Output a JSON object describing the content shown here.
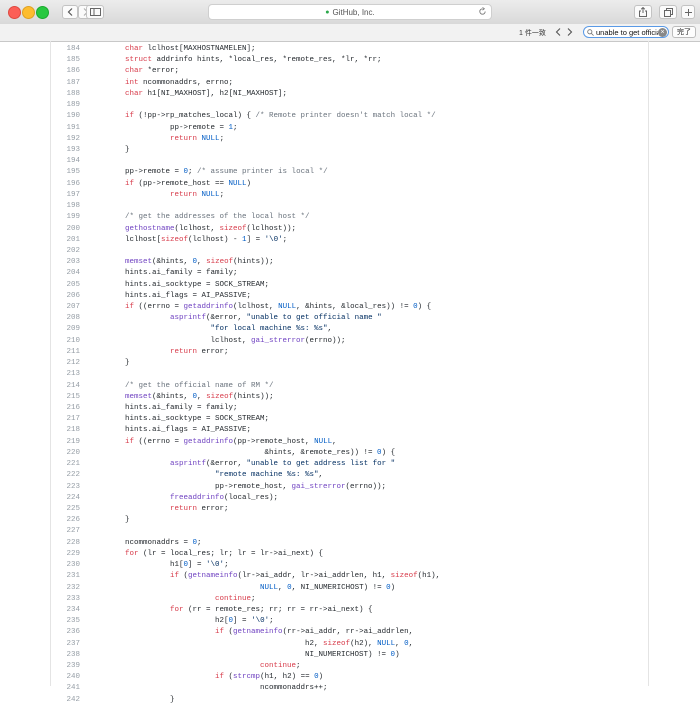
{
  "browser": {
    "address_text": "GitHub, Inc.",
    "find_match_count": "1 件一致",
    "find_query": "unable to get officia",
    "done_label": "完了"
  },
  "code": [
    {
      "n": "184",
      "t": [
        {
          "c": "k",
          "v": "char"
        },
        {
          "v": " lclhost[MAXHOSTNAMELEN];"
        }
      ]
    },
    {
      "n": "185",
      "t": [
        {
          "c": "k",
          "v": "struct"
        },
        {
          "v": " addrinfo hints, *local_res, *remote_res, *lr, *rr;"
        }
      ]
    },
    {
      "n": "186",
      "t": [
        {
          "c": "k",
          "v": "char"
        },
        {
          "v": " *error;"
        }
      ]
    },
    {
      "n": "187",
      "t": [
        {
          "c": "k",
          "v": "int"
        },
        {
          "v": " ncommonaddrs, errno;"
        }
      ]
    },
    {
      "n": "188",
      "t": [
        {
          "c": "k",
          "v": "char"
        },
        {
          "v": " h1[NI_MAXHOST], h2[NI_MAXHOST];"
        }
      ]
    },
    {
      "n": "189",
      "t": []
    },
    {
      "n": "190",
      "t": [
        {
          "c": "k",
          "v": "if"
        },
        {
          "v": " (!pp->rp_matches_local) { "
        },
        {
          "c": "c",
          "v": "/* Remote printer doesn't match local */"
        }
      ]
    },
    {
      "n": "191",
      "t": [
        {
          "v": "          pp->remote = "
        },
        {
          "c": "n",
          "v": "1"
        },
        {
          "v": ";"
        }
      ]
    },
    {
      "n": "192",
      "t": [
        {
          "v": "          "
        },
        {
          "c": "k",
          "v": "return"
        },
        {
          "v": " "
        },
        {
          "c": "n",
          "v": "NULL"
        },
        {
          "v": ";"
        }
      ]
    },
    {
      "n": "193",
      "t": [
        {
          "v": "}"
        }
      ]
    },
    {
      "n": "194",
      "t": []
    },
    {
      "n": "195",
      "t": [
        {
          "v": "pp->remote = "
        },
        {
          "c": "n",
          "v": "0"
        },
        {
          "v": "; "
        },
        {
          "c": "c",
          "v": "/* assume printer is local */"
        }
      ]
    },
    {
      "n": "196",
      "t": [
        {
          "c": "k",
          "v": "if"
        },
        {
          "v": " (pp->remote_host == "
        },
        {
          "c": "n",
          "v": "NULL"
        },
        {
          "v": ")"
        }
      ]
    },
    {
      "n": "197",
      "t": [
        {
          "v": "          "
        },
        {
          "c": "k",
          "v": "return"
        },
        {
          "v": " "
        },
        {
          "c": "n",
          "v": "NULL"
        },
        {
          "v": ";"
        }
      ]
    },
    {
      "n": "198",
      "t": []
    },
    {
      "n": "199",
      "t": [
        {
          "c": "c",
          "v": "/* get the addresses of the local host */"
        }
      ]
    },
    {
      "n": "200",
      "t": [
        {
          "c": "f",
          "v": "gethostname"
        },
        {
          "v": "(lclhost, "
        },
        {
          "c": "k",
          "v": "sizeof"
        },
        {
          "v": "(lclhost));"
        }
      ]
    },
    {
      "n": "201",
      "t": [
        {
          "v": "lclhost["
        },
        {
          "c": "k",
          "v": "sizeof"
        },
        {
          "v": "(lclhost) - "
        },
        {
          "c": "n",
          "v": "1"
        },
        {
          "v": "] = "
        },
        {
          "c": "s",
          "v": "'\\0'"
        },
        {
          "v": ";"
        }
      ]
    },
    {
      "n": "202",
      "t": []
    },
    {
      "n": "203",
      "t": [
        {
          "c": "f",
          "v": "memset"
        },
        {
          "v": "(&hints, "
        },
        {
          "c": "n",
          "v": "0"
        },
        {
          "v": ", "
        },
        {
          "c": "k",
          "v": "sizeof"
        },
        {
          "v": "(hints));"
        }
      ]
    },
    {
      "n": "204",
      "t": [
        {
          "v": "hints.ai_family = family;"
        }
      ]
    },
    {
      "n": "205",
      "t": [
        {
          "v": "hints.ai_socktype = SOCK_STREAM;"
        }
      ]
    },
    {
      "n": "206",
      "t": [
        {
          "v": "hints.ai_flags = AI_PASSIVE;"
        }
      ]
    },
    {
      "n": "207",
      "t": [
        {
          "c": "k",
          "v": "if"
        },
        {
          "v": " ((errno = "
        },
        {
          "c": "f",
          "v": "getaddrinfo"
        },
        {
          "v": "(lclhost, "
        },
        {
          "c": "n",
          "v": "NULL"
        },
        {
          "v": ", &hints, &local_res)) != "
        },
        {
          "c": "n",
          "v": "0"
        },
        {
          "v": ") {"
        }
      ]
    },
    {
      "n": "208",
      "t": [
        {
          "v": "          "
        },
        {
          "c": "f",
          "v": "asprintf"
        },
        {
          "v": "(&error, "
        },
        {
          "c": "s",
          "v": "\"unable to get official name \""
        }
      ]
    },
    {
      "n": "209",
      "t": [
        {
          "v": "                   "
        },
        {
          "c": "s",
          "v": "\"for local machine %s: %s\""
        },
        {
          "v": ","
        }
      ]
    },
    {
      "n": "210",
      "t": [
        {
          "v": "                   lclhost, "
        },
        {
          "c": "f",
          "v": "gai_strerror"
        },
        {
          "v": "(errno));"
        }
      ]
    },
    {
      "n": "211",
      "t": [
        {
          "v": "          "
        },
        {
          "c": "k",
          "v": "return"
        },
        {
          "v": " error;"
        }
      ]
    },
    {
      "n": "212",
      "t": [
        {
          "v": "}"
        }
      ]
    },
    {
      "n": "213",
      "t": []
    },
    {
      "n": "214",
      "t": [
        {
          "c": "c",
          "v": "/* get the official name of RM */"
        }
      ]
    },
    {
      "n": "215",
      "t": [
        {
          "c": "f",
          "v": "memset"
        },
        {
          "v": "(&hints, "
        },
        {
          "c": "n",
          "v": "0"
        },
        {
          "v": ", "
        },
        {
          "c": "k",
          "v": "sizeof"
        },
        {
          "v": "(hints));"
        }
      ]
    },
    {
      "n": "216",
      "t": [
        {
          "v": "hints.ai_family = family;"
        }
      ]
    },
    {
      "n": "217",
      "t": [
        {
          "v": "hints.ai_socktype = SOCK_STREAM;"
        }
      ]
    },
    {
      "n": "218",
      "t": [
        {
          "v": "hints.ai_flags = AI_PASSIVE;"
        }
      ]
    },
    {
      "n": "219",
      "t": [
        {
          "c": "k",
          "v": "if"
        },
        {
          "v": " ((errno = "
        },
        {
          "c": "f",
          "v": "getaddrinfo"
        },
        {
          "v": "(pp->remote_host, "
        },
        {
          "c": "n",
          "v": "NULL"
        },
        {
          "v": ","
        }
      ]
    },
    {
      "n": "220",
      "t": [
        {
          "v": "                               &hints, &remote_res)) != "
        },
        {
          "c": "n",
          "v": "0"
        },
        {
          "v": ") {"
        }
      ]
    },
    {
      "n": "221",
      "t": [
        {
          "v": "          "
        },
        {
          "c": "f",
          "v": "asprintf"
        },
        {
          "v": "(&error, "
        },
        {
          "c": "s",
          "v": "\"unable to get address list for \""
        }
      ]
    },
    {
      "n": "222",
      "t": [
        {
          "v": "                    "
        },
        {
          "c": "s",
          "v": "\"remote machine %s: %s\""
        },
        {
          "v": ","
        }
      ]
    },
    {
      "n": "223",
      "t": [
        {
          "v": "                    pp->remote_host, "
        },
        {
          "c": "f",
          "v": "gai_strerror"
        },
        {
          "v": "(errno));"
        }
      ]
    },
    {
      "n": "224",
      "t": [
        {
          "v": "          "
        },
        {
          "c": "f",
          "v": "freeaddrinfo"
        },
        {
          "v": "(local_res);"
        }
      ]
    },
    {
      "n": "225",
      "t": [
        {
          "v": "          "
        },
        {
          "c": "k",
          "v": "return"
        },
        {
          "v": " error;"
        }
      ]
    },
    {
      "n": "226",
      "t": [
        {
          "v": "}"
        }
      ]
    },
    {
      "n": "227",
      "t": []
    },
    {
      "n": "228",
      "t": [
        {
          "v": "ncommonaddrs = "
        },
        {
          "c": "n",
          "v": "0"
        },
        {
          "v": ";"
        }
      ]
    },
    {
      "n": "229",
      "t": [
        {
          "c": "k",
          "v": "for"
        },
        {
          "v": " (lr = local_res; lr; lr = lr->ai_next) {"
        }
      ]
    },
    {
      "n": "230",
      "t": [
        {
          "v": "          h1["
        },
        {
          "c": "n",
          "v": "0"
        },
        {
          "v": "] = "
        },
        {
          "c": "s",
          "v": "'\\0'"
        },
        {
          "v": ";"
        }
      ]
    },
    {
      "n": "231",
      "t": [
        {
          "v": "          "
        },
        {
          "c": "k",
          "v": "if"
        },
        {
          "v": " ("
        },
        {
          "c": "f",
          "v": "getnameinfo"
        },
        {
          "v": "(lr->ai_addr, lr->ai_addrlen, h1, "
        },
        {
          "c": "k",
          "v": "sizeof"
        },
        {
          "v": "(h1),"
        }
      ]
    },
    {
      "n": "232",
      "t": [
        {
          "v": "                              "
        },
        {
          "c": "n",
          "v": "NULL"
        },
        {
          "v": ", "
        },
        {
          "c": "n",
          "v": "0"
        },
        {
          "v": ", NI_NUMERICHOST) != "
        },
        {
          "c": "n",
          "v": "0"
        },
        {
          "v": ")"
        }
      ]
    },
    {
      "n": "233",
      "t": [
        {
          "v": "                    "
        },
        {
          "c": "k",
          "v": "continue"
        },
        {
          "v": ";"
        }
      ]
    },
    {
      "n": "234",
      "t": [
        {
          "v": "          "
        },
        {
          "c": "k",
          "v": "for"
        },
        {
          "v": " (rr = remote_res; rr; rr = rr->ai_next) {"
        }
      ]
    },
    {
      "n": "235",
      "t": [
        {
          "v": "                    h2["
        },
        {
          "c": "n",
          "v": "0"
        },
        {
          "v": "] = "
        },
        {
          "c": "s",
          "v": "'\\0'"
        },
        {
          "v": ";"
        }
      ]
    },
    {
      "n": "236",
      "t": [
        {
          "v": "                    "
        },
        {
          "c": "k",
          "v": "if"
        },
        {
          "v": " ("
        },
        {
          "c": "f",
          "v": "getnameinfo"
        },
        {
          "v": "(rr->ai_addr, rr->ai_addrlen,"
        }
      ]
    },
    {
      "n": "237",
      "t": [
        {
          "v": "                                        h2, "
        },
        {
          "c": "k",
          "v": "sizeof"
        },
        {
          "v": "(h2), "
        },
        {
          "c": "n",
          "v": "NULL"
        },
        {
          "v": ", "
        },
        {
          "c": "n",
          "v": "0"
        },
        {
          "v": ","
        }
      ]
    },
    {
      "n": "238",
      "t": [
        {
          "v": "                                        NI_NUMERICHOST) != "
        },
        {
          "c": "n",
          "v": "0"
        },
        {
          "v": ")"
        }
      ]
    },
    {
      "n": "239",
      "t": [
        {
          "v": "                              "
        },
        {
          "c": "k",
          "v": "continue"
        },
        {
          "v": ";"
        }
      ]
    },
    {
      "n": "240",
      "t": [
        {
          "v": "                    "
        },
        {
          "c": "k",
          "v": "if"
        },
        {
          "v": " ("
        },
        {
          "c": "f",
          "v": "strcmp"
        },
        {
          "v": "(h1, h2) == "
        },
        {
          "c": "n",
          "v": "0"
        },
        {
          "v": ")"
        }
      ]
    },
    {
      "n": "241",
      "t": [
        {
          "v": "                              ncommonaddrs++;"
        }
      ]
    },
    {
      "n": "242",
      "t": [
        {
          "v": "          }"
        }
      ]
    }
  ]
}
